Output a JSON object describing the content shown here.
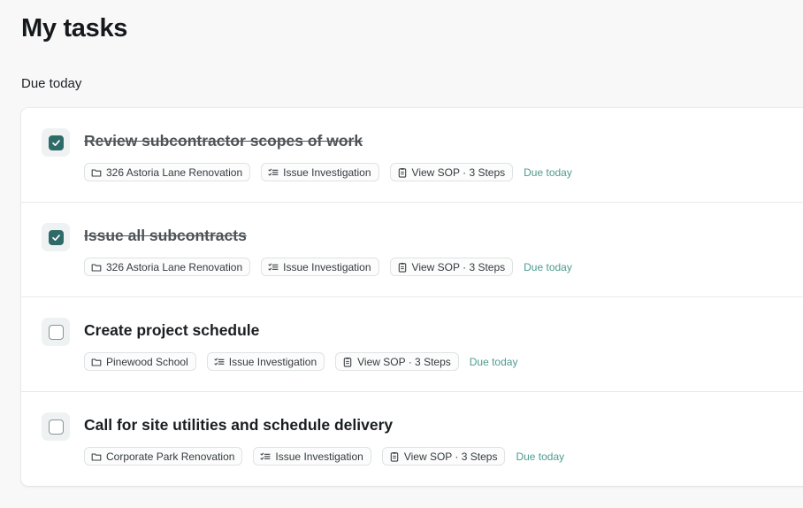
{
  "page": {
    "title": "My tasks"
  },
  "section": {
    "title": "Due today"
  },
  "tasks": [
    {
      "title": "Review subcontractor scopes of work",
      "completed": true,
      "project": "326 Astoria Lane Renovation",
      "category": "Issue Investigation",
      "sop": "View SOP · 3 Steps",
      "due": "Due today"
    },
    {
      "title": "Issue all subcontracts",
      "completed": true,
      "project": "326 Astoria Lane Renovation",
      "category": "Issue Investigation",
      "sop": "View SOP · 3 Steps",
      "due": "Due today"
    },
    {
      "title": "Create project schedule",
      "completed": false,
      "project": "Pinewood School",
      "category": "Issue Investigation",
      "sop": "View SOP · 3 Steps",
      "due": "Due today"
    },
    {
      "title": "Call for site utilities and schedule delivery",
      "completed": false,
      "project": "Corporate Park Renovation",
      "category": "Issue Investigation",
      "sop": "View SOP · 3 Steps",
      "due": "Due today"
    }
  ],
  "icons": {
    "checkbox_checked": "check-icon",
    "project": "folder-icon",
    "category": "list-icon",
    "sop": "clipboard-icon"
  },
  "colors": {
    "accent": "#2e6b68",
    "due_text": "#4d9c8f"
  }
}
